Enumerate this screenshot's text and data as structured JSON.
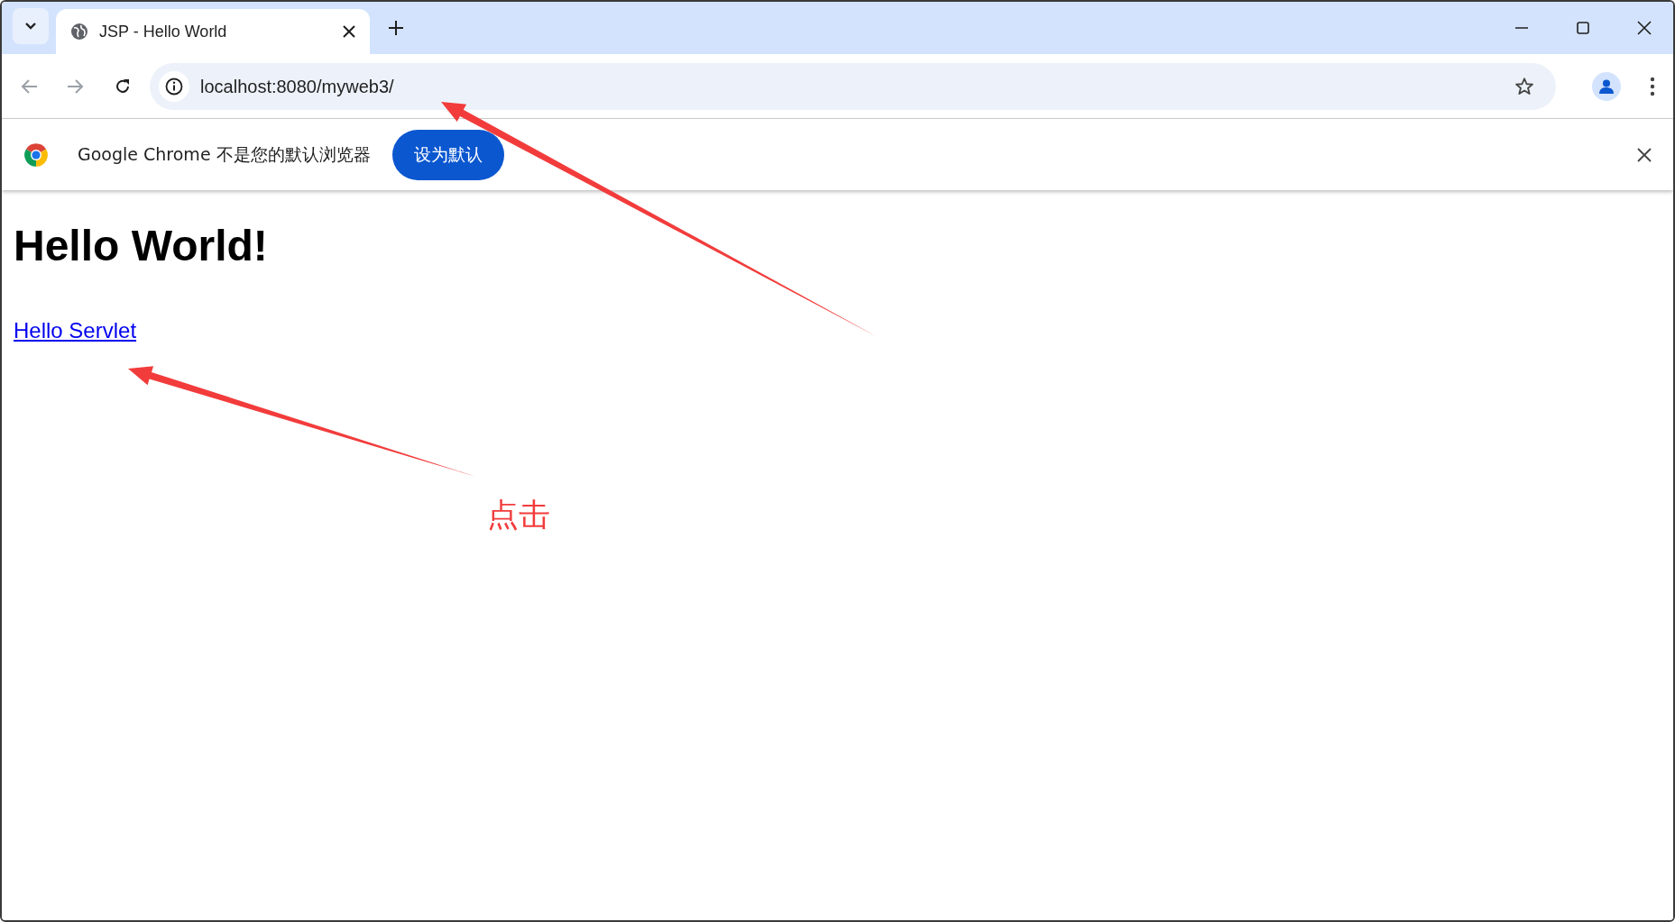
{
  "tab": {
    "title": "JSP - Hello World"
  },
  "address_bar": {
    "url": "localhost:8080/myweb3/"
  },
  "infobar": {
    "message": "Google Chrome 不是您的默认浏览器",
    "button": "设为默认"
  },
  "page": {
    "heading": "Hello World!",
    "link": "Hello Servlet"
  },
  "annotation": {
    "text": "点击"
  }
}
